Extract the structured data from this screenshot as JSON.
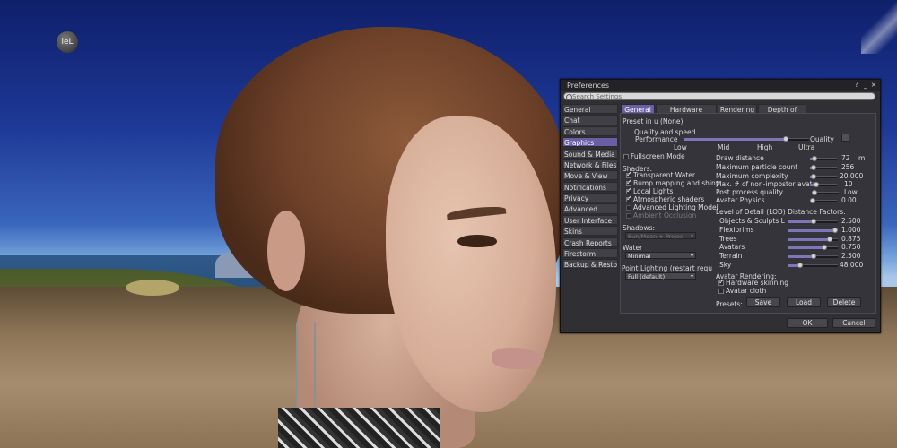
{
  "hud": {
    "badge_label": "ieL"
  },
  "window": {
    "title": "Preferences",
    "help_label": "?",
    "minimize_label": "_",
    "close_label": "×"
  },
  "search": {
    "placeholder": "Search Settings"
  },
  "sidebar": {
    "items": [
      {
        "label": "General"
      },
      {
        "label": "Chat"
      },
      {
        "label": "Colors"
      },
      {
        "label": "Graphics"
      },
      {
        "label": "Sound & Media"
      },
      {
        "label": "Network & Files"
      },
      {
        "label": "Move & View"
      },
      {
        "label": "Notifications"
      },
      {
        "label": "Privacy"
      },
      {
        "label": "Advanced"
      },
      {
        "label": "User Interface"
      },
      {
        "label": "Skins"
      },
      {
        "label": "Crash Reports"
      },
      {
        "label": "Firestorm"
      },
      {
        "label": "Backup & Resto"
      }
    ],
    "selected": "Graphics"
  },
  "tabs": [
    {
      "label": "General"
    },
    {
      "label": "Hardware Settings"
    },
    {
      "label": "Rendering"
    },
    {
      "label": "Depth of Field"
    }
  ],
  "general": {
    "preset_label": "Preset in u",
    "preset_value": "(None)",
    "quality_label": "Quality and speed",
    "performance_label": "Performance",
    "quality_end_label": "Quality",
    "quality_fraction": 0.83,
    "ticks": [
      "Low",
      "Mid",
      "High",
      "Ultra"
    ],
    "fullscreen_label": "Fullscreen Mode",
    "fullscreen_checked": false,
    "shaders_label": "Shaders:",
    "shaders": [
      {
        "label": "Transparent Water",
        "checked": true,
        "enabled": true
      },
      {
        "label": "Bump mapping and shiny",
        "checked": true,
        "enabled": true
      },
      {
        "label": "Local Lights",
        "checked": true,
        "enabled": true
      },
      {
        "label": "Atmospheric shaders",
        "checked": true,
        "enabled": true
      },
      {
        "label": "Advanced Lighting Model",
        "checked": false,
        "enabled": false
      },
      {
        "label": "Ambient Occlusion",
        "checked": false,
        "enabled": false
      }
    ],
    "shadows_label": "Shadows:",
    "shadows_value": "Sun/Moon + Projec",
    "water_label": "Water",
    "water_value": "Minimal",
    "point_lighting_label": "Point Lighting (restart requ",
    "point_lighting_value": "Full (default)"
  },
  "right": {
    "draw_distance": {
      "label": "Draw distance",
      "value": "72",
      "unit": "m",
      "fraction": 0.08
    },
    "particle_count": {
      "label": "Maximum particle count",
      "value": "256",
      "fraction": 0.04
    },
    "max_complexity": {
      "label": "Maximum complexity",
      "value": "20,000",
      "fraction": 0.03
    },
    "non_impostor": {
      "label": "Max. # of non-impostor avata",
      "value": "10",
      "fraction": 0.15
    },
    "post_process": {
      "label": "Post process quality",
      "value": "Low",
      "fraction": 0.0
    },
    "avatar_physics": {
      "label": "Avatar Physics",
      "value": "0.00",
      "fraction": 0.0
    },
    "lod_label": "Level of Detail (LOD) Distance Factors:",
    "lod": [
      {
        "label": "Objects & Sculpts L",
        "value": "2.500",
        "fraction": 0.5
      },
      {
        "label": "Flexiprims",
        "value": "1.000",
        "fraction": 1.0
      },
      {
        "label": "Trees",
        "value": "0.875",
        "fraction": 0.875
      },
      {
        "label": "Avatars",
        "value": "0.750",
        "fraction": 0.75
      },
      {
        "label": "Terrain",
        "value": "2.500",
        "fraction": 0.5
      },
      {
        "label": "Sky",
        "value": "48.000",
        "fraction": 0.2
      }
    ],
    "avatar_rendering_label": "Avatar Rendering:",
    "hardware_skinning_label": "Hardware skinning",
    "hardware_skinning_checked": true,
    "avatar_cloth_label": "Avatar cloth",
    "avatar_cloth_checked": false,
    "presets_label": "Presets:",
    "save_label": "Save",
    "load_label": "Load",
    "delete_label": "Delete"
  },
  "footer": {
    "ok_label": "OK",
    "cancel_label": "Cancel"
  },
  "colors": {
    "accent": "#6a5fa6",
    "panel": "#303034"
  }
}
